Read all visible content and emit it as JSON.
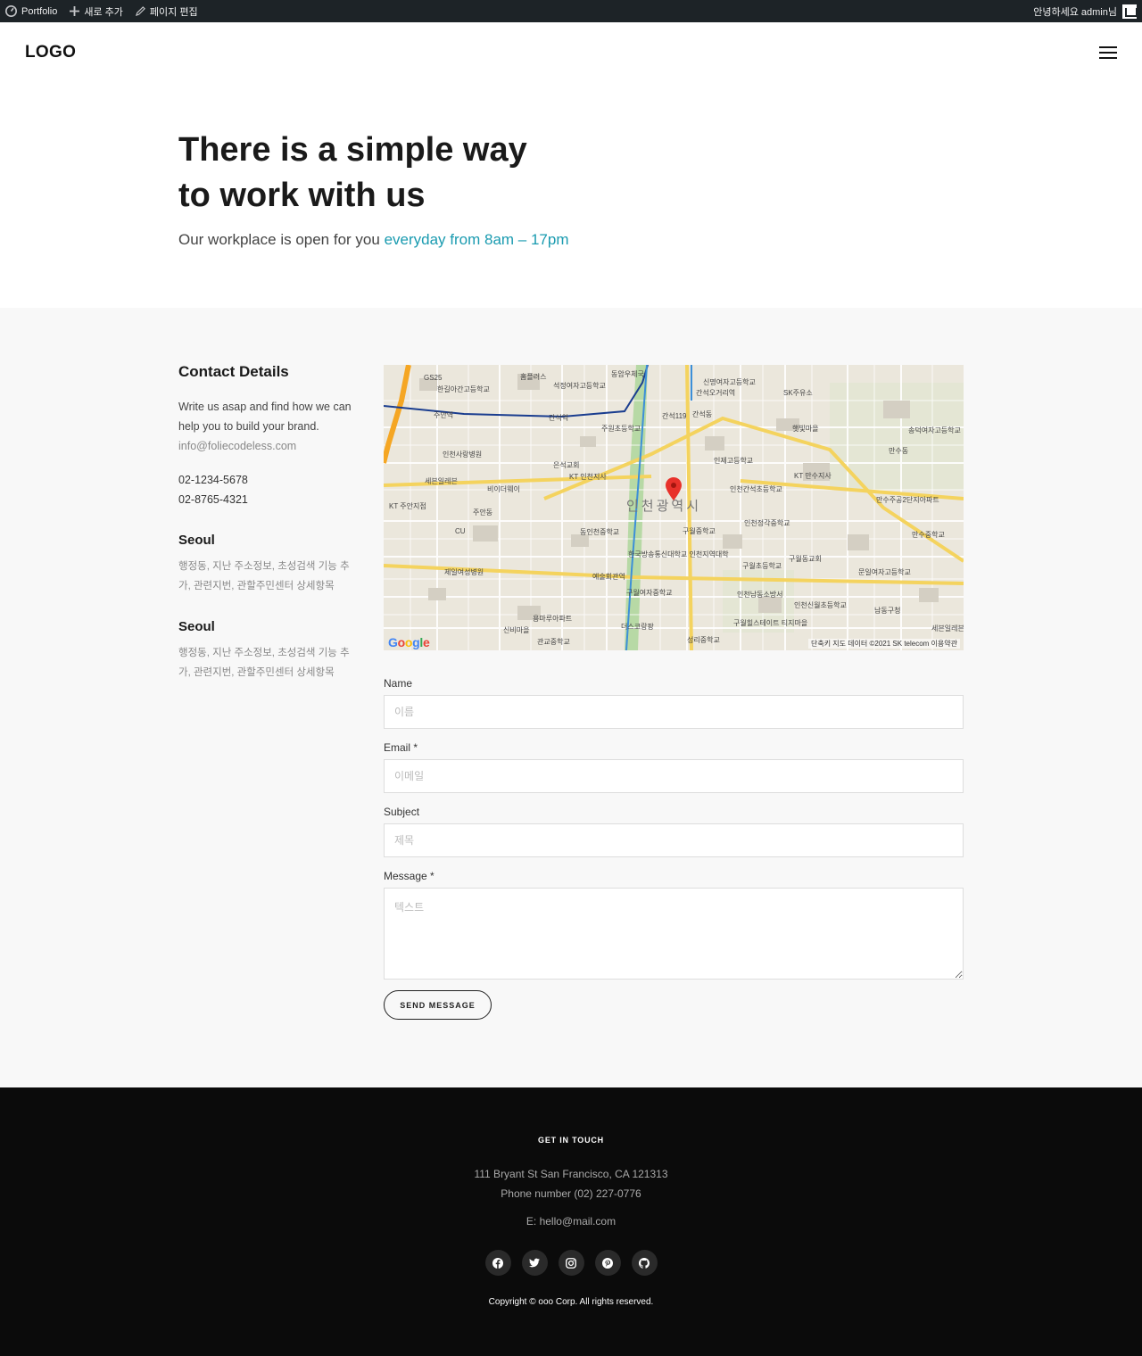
{
  "adminbar": {
    "site": "Portfolio",
    "new": "새로 추가",
    "edit": "페이지 편집",
    "greeting": "안녕하세요 admin님"
  },
  "header": {
    "logo": "LOGO"
  },
  "hero": {
    "title_line1": "There is a simple way",
    "title_line2": "to work with us",
    "subtitle": "Our workplace is open for you",
    "subtitle_accent": "everyday from 8am – 17pm",
    "accent_color": "#1a9bb0"
  },
  "details": {
    "heading": "Contact Details",
    "text": "Write us asap and find how we can help you to build your brand.",
    "email": "info@foliecodeless.com",
    "phone1": "02-1234-5678",
    "phone2": "02-8765-4321",
    "locations": [
      {
        "city": "Seoul",
        "address": "행정동, 지난 주소정보, 초성검색 기능 추가, 관련지번, 관할주민센터 상세항목"
      },
      {
        "city": "Seoul",
        "address": "행정동, 지난 주소정보, 초성검색 기능 추가, 관련지번, 관할주민센터 상세항목"
      }
    ]
  },
  "map": {
    "city_label": "인천광역시",
    "footer": "단축키   지도 데이터 ©2021 SK telecom   이용약관",
    "labels": [
      "GS25",
      "한길아간고등학교",
      "홈플러스",
      "석정여자고등학교",
      "동암우체국",
      "신명여자고등학교",
      "간석오거리역",
      "SK주유소",
      "주안역",
      "간석역",
      "주원초등학교",
      "간석119",
      "간석동",
      "햇빛마을",
      "송덕여자고등학교",
      "인천사랑병원",
      "은석교회",
      "KT 인천지사",
      "인제고등학교",
      "KT 만수지사",
      "만수동",
      "세븐일레븐",
      "비이더웨이",
      "인천간석초등학교",
      "만수주공2단지아파트",
      "KT 주안지점",
      "주안동",
      "동인천중학교",
      "구월중학교",
      "인천정각중학교",
      "만수중학교",
      "제일여성병원",
      "예술회관역",
      "한국방송통신대학교 인천지역대학",
      "구월초등학교",
      "구월동교회",
      "문일여자고등학교",
      "구월여자중학교",
      "인천남동소방서",
      "인천신월초등학교",
      "남동구청",
      "용마루아파트",
      "신비마을",
      "관교중학교",
      "더스코랑팡",
      "성리중학교",
      "구월힐스테이트 티지마을",
      "세븐일레븐",
      "CU"
    ]
  },
  "form": {
    "name_label": "Name",
    "name_placeholder": "이름",
    "email_label": "Email *",
    "email_placeholder": "이메일",
    "subject_label": "Subject",
    "subject_placeholder": "제목",
    "message_label": "Message *",
    "message_placeholder": "텍스트",
    "send_label": "SEND MESSAGE"
  },
  "footer": {
    "title": "GET IN TOUCH",
    "address": "111 Bryant St San Francisco, CA 121313",
    "phone": "Phone number (02) 227-0776",
    "email": "E: hello@mail.com",
    "socials": [
      "facebook-icon",
      "twitter-icon",
      "instagram-icon",
      "pinterest-icon",
      "github-icon"
    ],
    "copyright": "Copyright © ooo Corp. All rights reserved."
  }
}
